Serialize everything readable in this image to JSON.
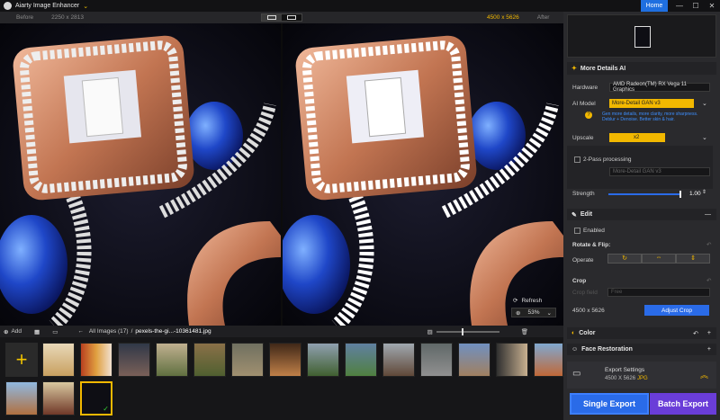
{
  "app": {
    "title": "Aiarty Image Enhancer",
    "home_label": "Home",
    "minimize": "—",
    "maximize": "☐",
    "close": "✕"
  },
  "view": {
    "before_label": "Before",
    "before_size": "2250 x 2813",
    "after_size": "4500 x 5626",
    "after_label": "After"
  },
  "canvas": {
    "refresh_label": "Refresh",
    "zoom": "53%"
  },
  "bottom": {
    "add_label": "Add",
    "breadcrumb": "All Images (17)",
    "sep": "/",
    "filename": "pexels-the-gi...-10361481.jpg"
  },
  "panel": {
    "more_details_title": "More Details AI",
    "hardware_label": "Hardware",
    "hardware_value": "AMD Radeon(TM) RX Vega 11 Graphics",
    "ai_model_label": "AI Model",
    "ai_model_value": "More-Detail GAN  v3",
    "ai_model_desc": "Gen more details, more clarity, more sharpness. Deblur + Denoise. Better skin & hair.",
    "upscale_label": "Upscale",
    "upscale_value": "x2",
    "two_pass_label": "2-Pass processing",
    "two_pass_model": "More-Detail GAN  v3",
    "strength_label": "Strength",
    "strength_value": "1.00",
    "edit_title": "Edit",
    "enabled_label": "Enabled",
    "rotate_label": "Rotate & Flip:",
    "operate_label": "Operate",
    "crop_label": "Crop",
    "crop_field_label": "Crop field",
    "crop_field_value": "Free",
    "crop_size": "4500 x 5626",
    "adjust_crop_label": "Adjust Crop",
    "color_title": "Color",
    "face_title": "Face Restoration",
    "export_title": "Export Settings",
    "export_size": "4500 X 5626",
    "export_format": "JPG",
    "single_export": "Single Export",
    "batch_export": "Batch Export"
  },
  "colors": {
    "accent": "#f2b800",
    "blue": "#2a6be8",
    "purple": "#6a3dd8"
  }
}
